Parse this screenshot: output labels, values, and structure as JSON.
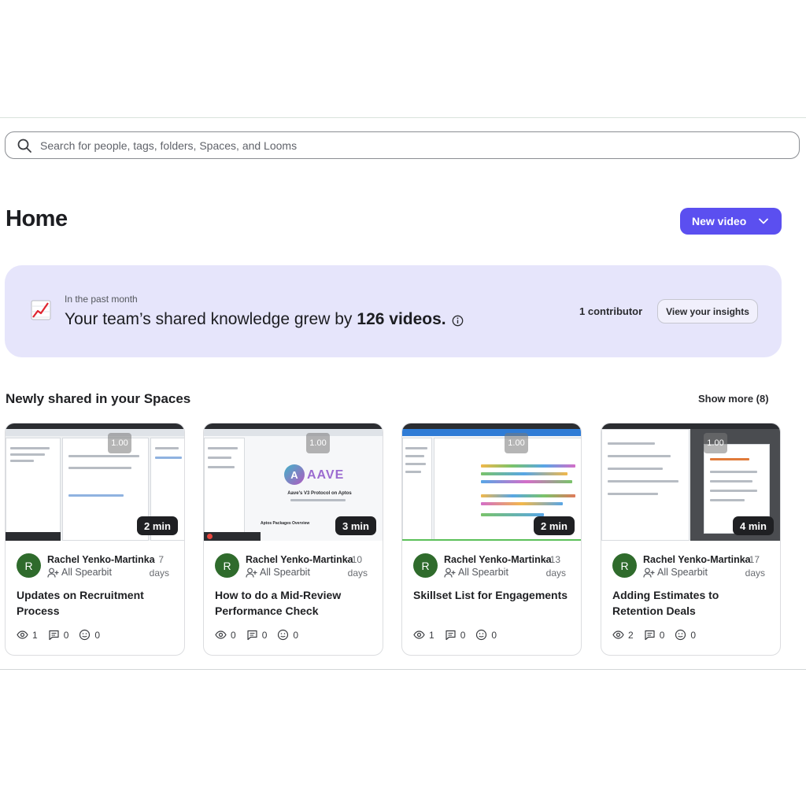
{
  "search": {
    "placeholder": "Search for people, tags, folders, Spaces, and Looms"
  },
  "header": {
    "title": "Home",
    "new_video_label": "New video"
  },
  "insight": {
    "subtitle": "In the past month",
    "headline_prefix": "Your team’s shared knowledge grew by",
    "headline_count": "126 videos.",
    "contributors": "1 contributor",
    "button_label": "View your insights"
  },
  "section": {
    "title": "Newly shared in your Spaces",
    "show_more": "Show more (8)"
  },
  "cards": [
    {
      "speed": "1.00",
      "duration": "2 min",
      "avatar": "R",
      "author": "Rachel Yenko-Martinka",
      "ago_num": "· 7",
      "ago_unit": "days",
      "space": "All Spearbit",
      "title": "Updates on Recruitment Process",
      "views": "1",
      "comments": "0",
      "reactions": "0"
    },
    {
      "speed": "1.00",
      "duration": "3 min",
      "avatar": "R",
      "author": "Rachel Yenko-Martinka",
      "ago_num": "· 10",
      "ago_unit": "days",
      "space": "All Spearbit",
      "title": "How to do a Mid-Review Performance Check",
      "views": "0",
      "comments": "0",
      "reactions": "0"
    },
    {
      "speed": "1.00",
      "duration": "2 min",
      "avatar": "R",
      "author": "Rachel Yenko-Martinka",
      "ago_num": "· 13",
      "ago_unit": "days",
      "space": "All Spearbit",
      "title": "Skillset List for Engagements",
      "views": "1",
      "comments": "0",
      "reactions": "0"
    },
    {
      "speed": "1.00",
      "duration": "4 min",
      "avatar": "R",
      "author": "Rachel Yenko-Martinka",
      "ago_num": "· 17",
      "ago_unit": "days",
      "space": "All Spearbit",
      "title": "Adding Estimates to Retention Deals",
      "views": "2",
      "comments": "0",
      "reactions": "0"
    }
  ],
  "thumbnail_texts": {
    "aave_logo": "AAVE",
    "aave_heading": "Aave's V3 Protocol on Aptos",
    "aave_sub": "Aptos Packages Overview"
  },
  "icons": {
    "search": "search-icon",
    "chevron": "chevron-down-icon",
    "chart": "chart-increasing-icon",
    "info": "info-icon",
    "space": "add-user-icon",
    "views": "eye-icon",
    "comments": "comment-icon",
    "reactions": "smiley-icon"
  },
  "colors": {
    "primary": "#5b4ff0",
    "insight_bg": "#e6e5fb",
    "avatar": "#2f6b2c"
  }
}
